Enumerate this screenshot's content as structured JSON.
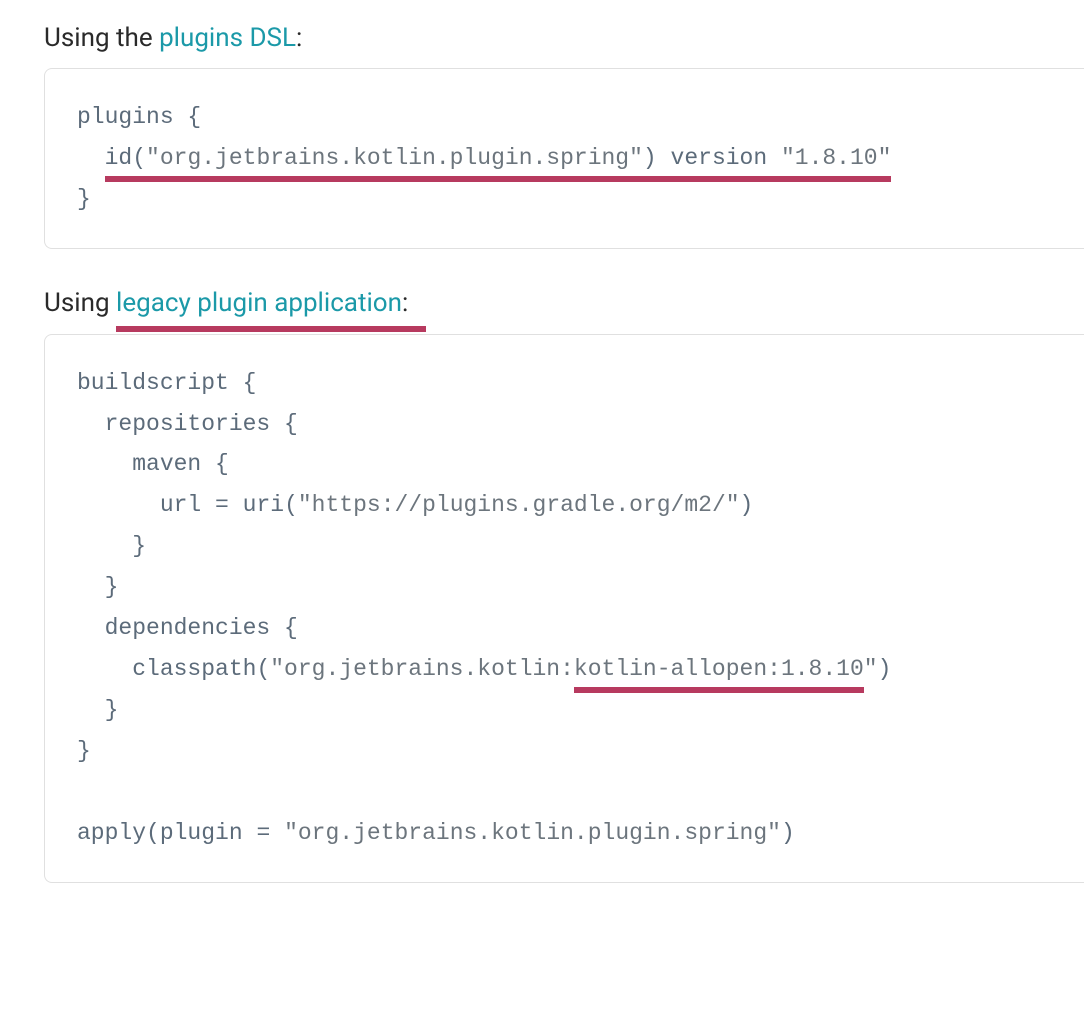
{
  "section1": {
    "heading_prefix": "Using the ",
    "heading_link": "plugins DSL",
    "heading_suffix": ":",
    "code": {
      "line1_a": "plugins {",
      "line2_indent": "  ",
      "line2_id": "id",
      "line2_paren_open": "(",
      "line2_string": "\"org.jetbrains.kotlin.plugin.spring\"",
      "line2_paren_close": ")",
      "line2_version_kw": " version ",
      "line2_version_str": "\"1.8.10\"",
      "line3_close": "}"
    }
  },
  "section2": {
    "heading_prefix": "Using ",
    "heading_link": "legacy plugin application",
    "heading_suffix": ":",
    "code": {
      "l1": "buildscript {",
      "l2": "  repositories {",
      "l3": "    maven {",
      "l4_a": "      url ",
      "l4_eq": "=",
      "l4_b": " uri",
      "l4_paren_open": "(",
      "l4_string": "\"https://plugins.gradle.org/m2/\"",
      "l4_paren_close": ")",
      "l5": "    }",
      "l6": "  }",
      "l7": "  dependencies {",
      "l8_a": "    classpath",
      "l8_paren_open": "(",
      "l8_string_a": "\"org.jetbrains.kotlin:",
      "l8_string_b": "kotlin-allopen:1.8.10",
      "l8_string_c": "\"",
      "l8_paren_close": ")",
      "l9": "  }",
      "l10": "}",
      "l11": "",
      "l12_a": "apply",
      "l12_paren_open": "(",
      "l12_plugin": "plugin ",
      "l12_eq": "=",
      "l12_space": " ",
      "l12_string": "\"org.jetbrains.kotlin.plugin.spring\"",
      "l12_paren_close": ")"
    }
  }
}
